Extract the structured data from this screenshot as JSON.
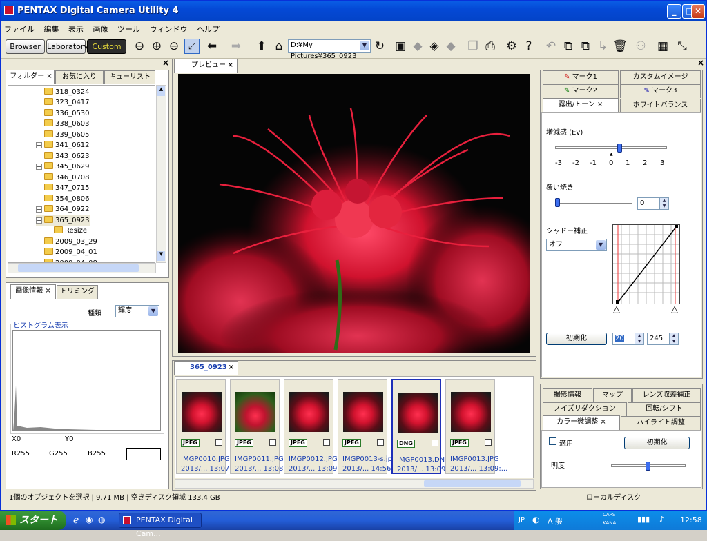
{
  "window": {
    "title": "PENTAX Digital Camera Utility 4"
  },
  "menu": [
    "ファイル",
    "編集",
    "表示",
    "画像",
    "ツール",
    "ウィンドウ",
    "ヘルプ"
  ],
  "modes": {
    "browser": "Browser",
    "laboratory": "Laboratory",
    "custom": "Custom"
  },
  "path": {
    "value": "D:¥My Pictures¥365_0923"
  },
  "left_tabs": [
    "フォルダー",
    "お気に入り",
    "キューリスト"
  ],
  "tree": [
    {
      "label": "318_0324",
      "expand": false
    },
    {
      "label": "323_0417",
      "expand": false
    },
    {
      "label": "336_0530",
      "expand": false
    },
    {
      "label": "338_0603",
      "expand": false
    },
    {
      "label": "339_0605",
      "expand": false
    },
    {
      "label": "341_0612",
      "expand": true
    },
    {
      "label": "343_0623",
      "expand": false
    },
    {
      "label": "345_0629",
      "expand": true
    },
    {
      "label": "346_0708",
      "expand": false
    },
    {
      "label": "347_0715",
      "expand": false
    },
    {
      "label": "354_0806",
      "expand": false
    },
    {
      "label": "364_0922",
      "expand": true
    },
    {
      "label": "365_0923",
      "expand": "open"
    },
    {
      "label": "Resize",
      "expand": false,
      "child": true
    },
    {
      "label": "2009_03_29",
      "expand": false
    },
    {
      "label": "2009_04_01",
      "expand": false
    },
    {
      "label": "2009_04_08",
      "expand": false
    }
  ],
  "info_tabs": [
    "画像情報",
    "トリミング"
  ],
  "info": {
    "type_label": "種類",
    "type_value": "輝度",
    "histogram_label": "ヒストグラム表示",
    "x0": "X0",
    "y0": "Y0",
    "r": "R255",
    "g": "G255",
    "b": "B255"
  },
  "preview_tab": "プレビュー",
  "folder_tab": "365_0923",
  "thumbnails": [
    {
      "name": "IMGP0010.JPG",
      "date": "2013/...   13:07:...",
      "format": "JPEG",
      "selected": false
    },
    {
      "name": "IMGP0011.JPG",
      "date": "2013/...   13:08:...",
      "format": "JPEG",
      "selected": false
    },
    {
      "name": "IMGP0012.JPG",
      "date": "2013/...   13:09:...",
      "format": "JPEG",
      "selected": false
    },
    {
      "name": "IMGP0013-s.jpg",
      "date": "2013/...   14:56:...",
      "format": "JPEG",
      "selected": false
    },
    {
      "name": "IMGP0013.DNG",
      "date": "2013/...   13:09:...",
      "format": "DNG",
      "selected": true
    },
    {
      "name": "IMGP0013.JPG",
      "date": "2013/...   13:09:...",
      "format": "JPEG",
      "selected": false
    }
  ],
  "right_tabs_top": {
    "mark1": "マーク1",
    "custom_image": "カスタムイメージ",
    "mark2": "マーク2",
    "mark3": "マーク3",
    "exposure": "露出/トーン",
    "white_balance": "ホワイトバランス"
  },
  "exposure": {
    "ev_label": "増減感 (Ev)",
    "ev_ticks": [
      "-3",
      "-2",
      "-1",
      "0",
      "1",
      "2",
      "3"
    ],
    "ev_value": 0.5,
    "burn_label": "覆い焼き",
    "burn_value": "0",
    "shadow_label": "シャドー補正",
    "shadow_value": "オフ",
    "reset": "初期化",
    "in_value": "20",
    "out_value": "245"
  },
  "right_tabs_bottom": [
    "撮影情報",
    "マップ",
    "レンズ収差補正",
    "ノイズリダクション",
    "回転/シフト",
    "カラー微調整",
    "ハイライト調整"
  ],
  "color_adjust": {
    "apply_label": "適用",
    "reset": "初期化",
    "brightness_label": "明度"
  },
  "status": {
    "left": "1個のオブジェクトを選択 | 9.71 MB | 空きディスク領域 133.4 GB",
    "right": "ローカルディスク"
  },
  "taskbar": {
    "start": "スタート",
    "task": "PENTAX Digital Cam...",
    "lang": "JP",
    "ime": "A 般",
    "caps": "CAPS",
    "kana": "KANA",
    "time": "12:58"
  }
}
